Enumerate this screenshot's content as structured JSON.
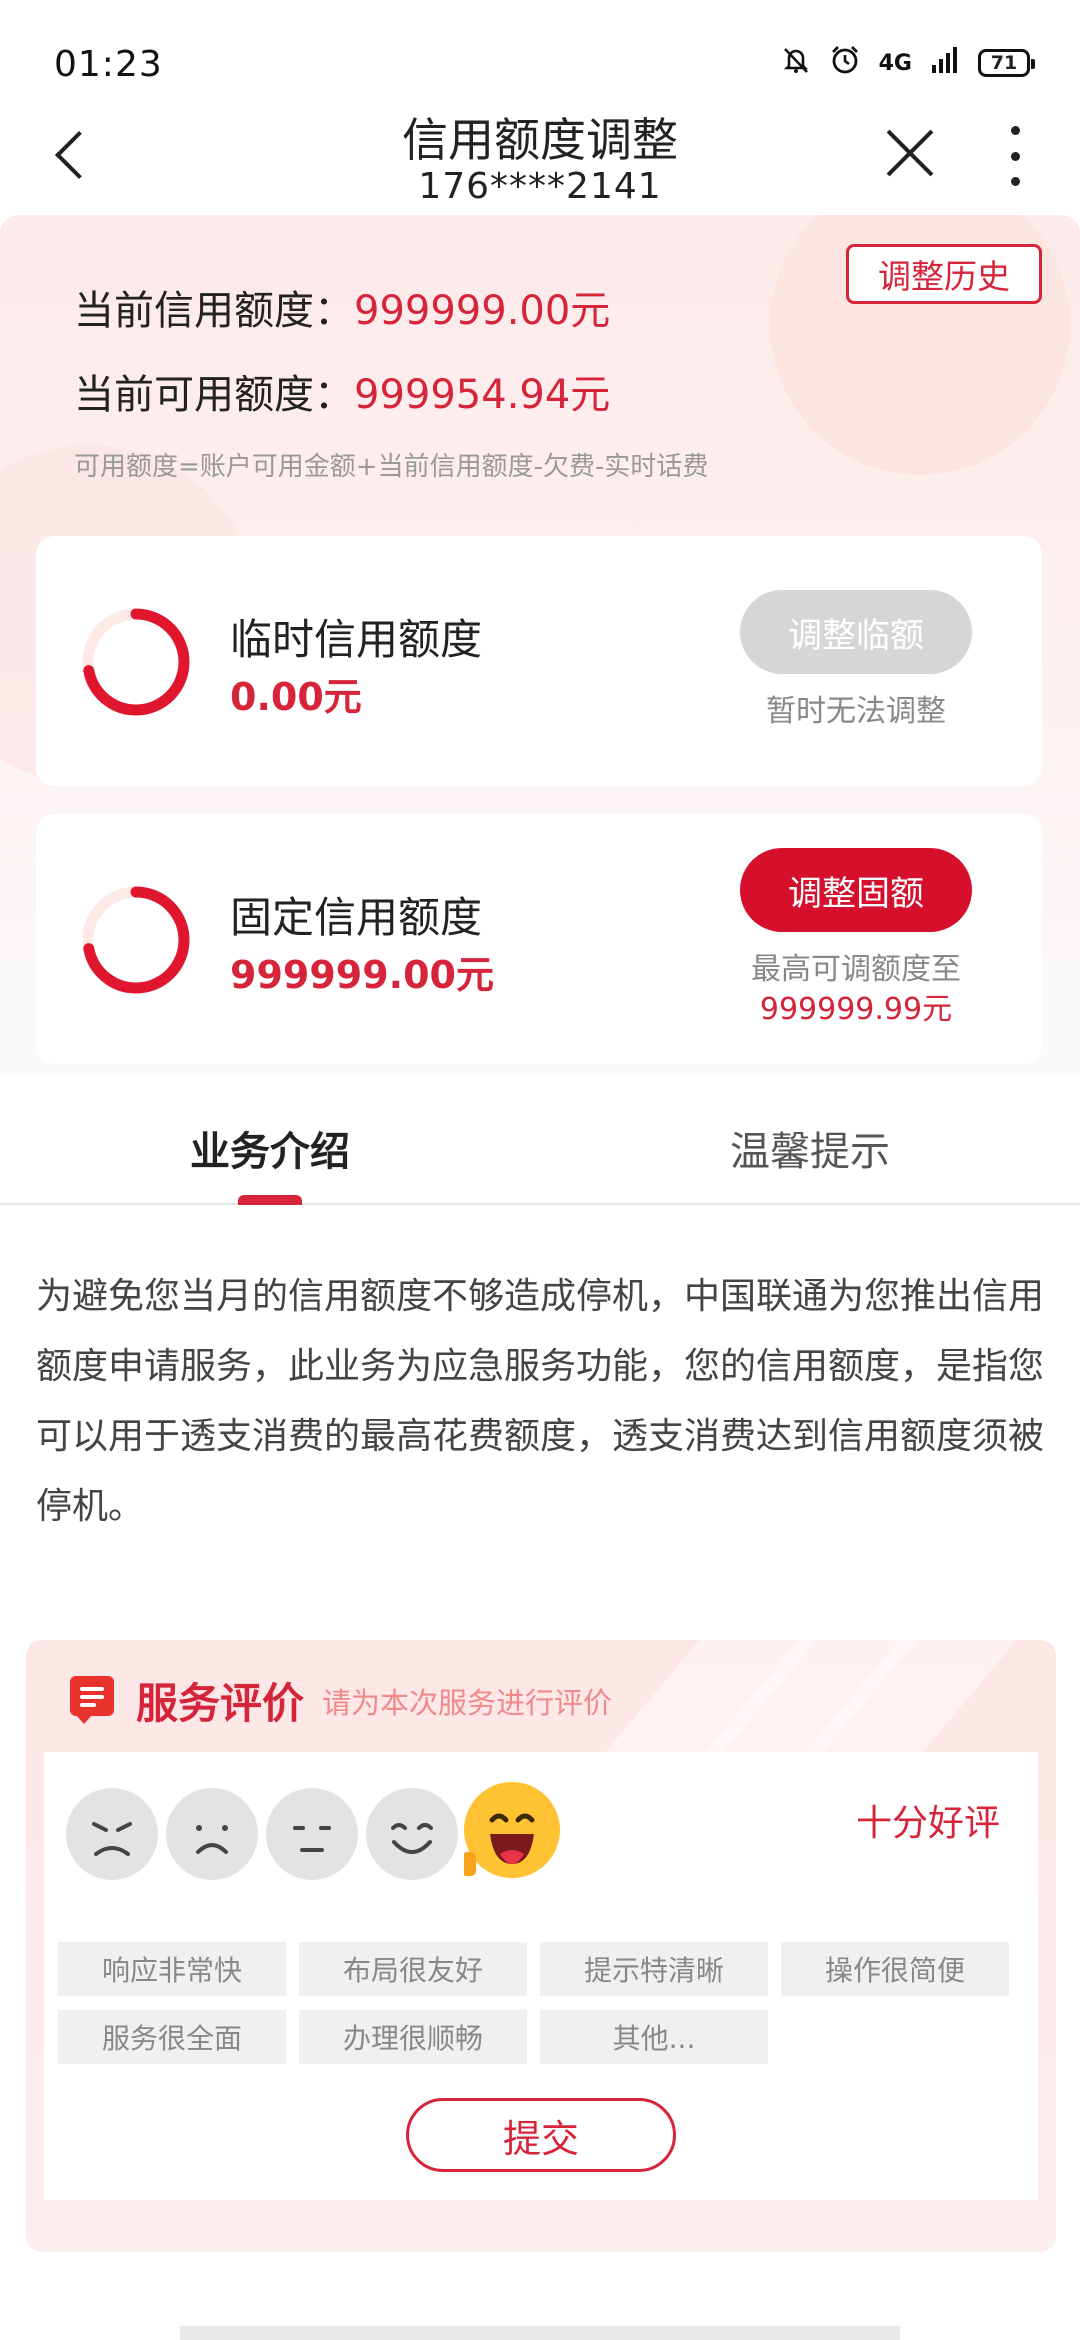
{
  "status_bar": {
    "time": "01:23",
    "network": "4G",
    "battery": "71"
  },
  "nav": {
    "title": "信用额度调整",
    "subtitle": "176****2141"
  },
  "summary": {
    "history_button": "调整历史",
    "current_credit_label": "当前信用额度：",
    "current_credit_value": "999999.00元",
    "available_credit_label": "当前可用额度：",
    "available_credit_value": "999954.94元",
    "formula": "可用额度=账户可用金额+当前信用额度-欠费-实时话费"
  },
  "temporary_card": {
    "title": "临时信用额度",
    "value": "0.00元",
    "button": "调整临额",
    "note": "暂时无法调整",
    "ring_fill": 0.72
  },
  "fixed_card": {
    "title": "固定信用额度",
    "value": "999999.00元",
    "button": "调整固额",
    "note_line1": "最高可调额度至",
    "note_line2": "999999.99元",
    "ring_fill": 0.72
  },
  "tabs": [
    {
      "label": "业务介绍",
      "active": true
    },
    {
      "label": "温馨提示",
      "active": false
    }
  ],
  "description": "为避免您当月的信用额度不够造成停机，中国联通为您推出信用额度申请服务，此业务为应急服务功能，您的信用额度，是指您可以用于透支消费的最高花费额度，透支消费达到信用额度须被停机。",
  "rating": {
    "title": "服务评价",
    "subtitle": "请为本次服务进行评价",
    "faces": [
      "angry-face-icon",
      "sad-face-icon",
      "neutral-face-icon",
      "smile-face-icon",
      "laughing-face-icon"
    ],
    "selected_label": "十分好评",
    "tags": [
      "响应非常快",
      "布局很友好",
      "提示特清晰",
      "操作很简便",
      "服务很全面",
      "办理很顺畅",
      "其他..."
    ],
    "submit": "提交"
  },
  "colors": {
    "accent": "#d6243a",
    "button_red": "#d60f2d",
    "button_disabled": "#d6d6d6"
  }
}
